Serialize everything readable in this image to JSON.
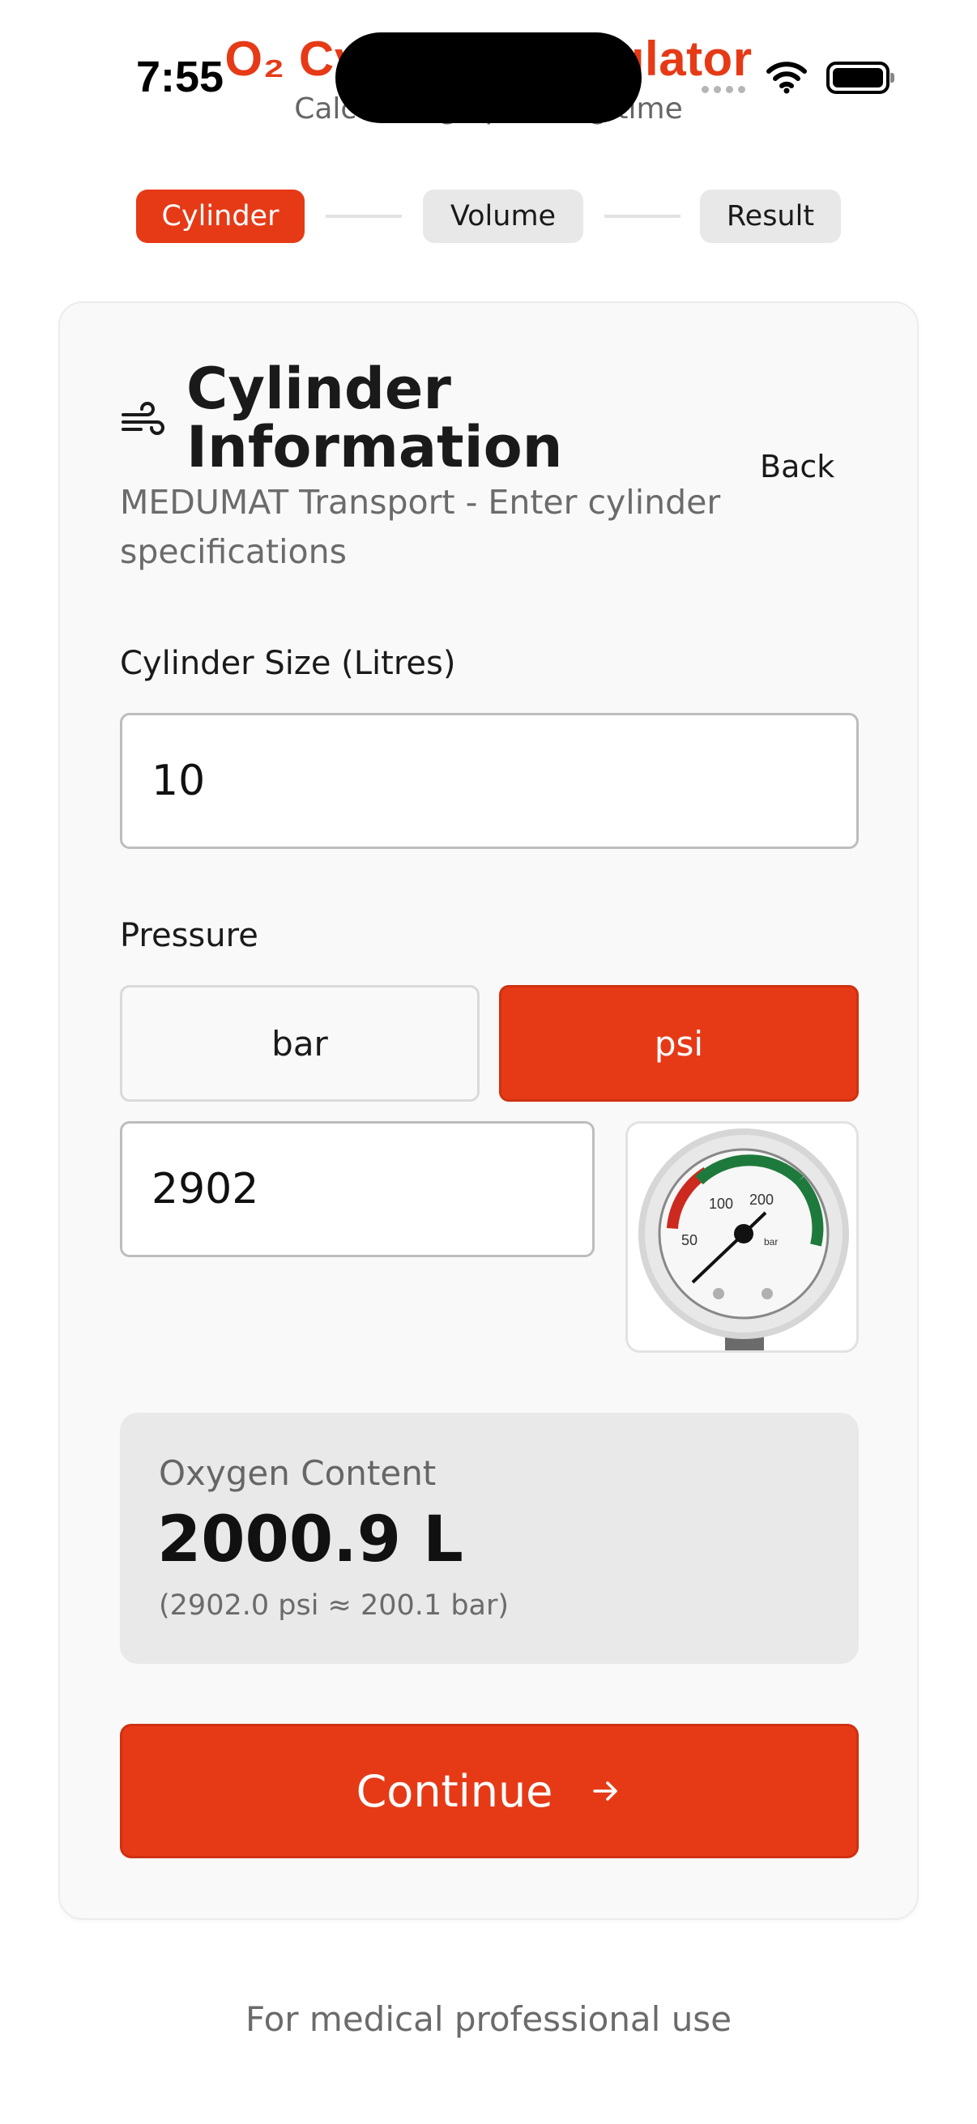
{
  "status_bar": {
    "time": "7:55"
  },
  "app": {
    "title": "O₂ Cylinder Calculator",
    "subtitle": "Calculating operating time"
  },
  "stepper": [
    {
      "label": "Cylinder",
      "active": true
    },
    {
      "label": "Volume",
      "active": false
    },
    {
      "label": "Result",
      "active": false
    }
  ],
  "card": {
    "title": "Cylinder Information",
    "back_label": "Back",
    "description": "MEDUMAT Transport - Enter cylinder specifications",
    "icon": "wind-icon"
  },
  "cylinder_size": {
    "label": "Cylinder Size (Litres)",
    "value": "10"
  },
  "pressure": {
    "label": "Pressure",
    "units": [
      {
        "label": "bar",
        "selected": false
      },
      {
        "label": "psi",
        "selected": true
      }
    ],
    "value": "2902",
    "gauge_image": "pressure-gauge-image"
  },
  "result": {
    "label": "Oxygen Content",
    "value": "2000.9 L",
    "note": "(2902.0 psi ≈ 200.1 bar)"
  },
  "continue_button": {
    "label": "Continue",
    "icon": "arrow-right-icon"
  },
  "footer": {
    "text": "For medical professional use"
  },
  "colors": {
    "accent": "#e63a17",
    "card_bg": "#f9f9f9",
    "muted_text": "#6b6b6b"
  }
}
